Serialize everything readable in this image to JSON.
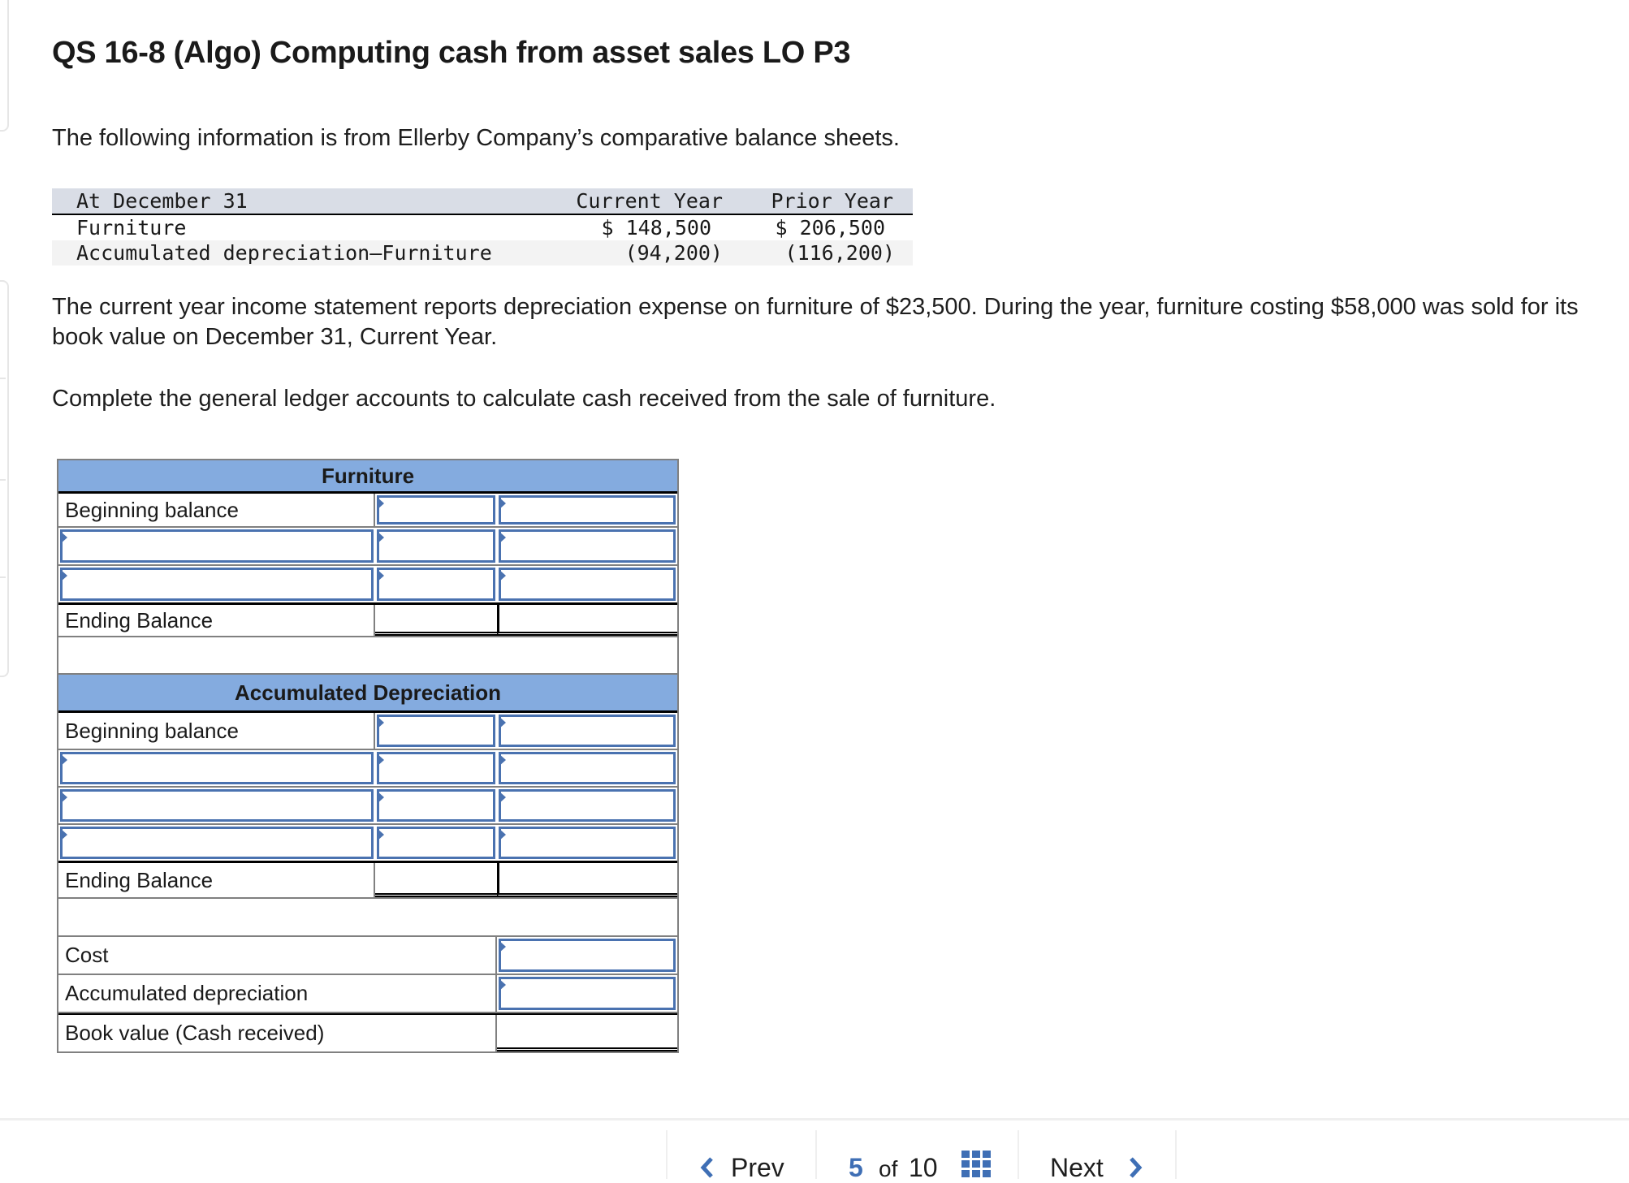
{
  "question": {
    "title": "QS 16-8 (Algo) Computing cash from asset sales LO P3",
    "intro": "The following information is from Ellerby Company’s comparative balance sheets.",
    "description": "The current year income statement reports depreciation expense on furniture of $23,500. During the year, furniture costing $58,000 was sold for its book value on December 31, Current Year.",
    "instruction": "Complete the general ledger accounts to calculate cash received from the sale of furniture."
  },
  "balance_sheet": {
    "headers": [
      "At December 31",
      "Current Year",
      "Prior Year"
    ],
    "rows": [
      {
        "label": "Furniture",
        "current": "$ 148,500",
        "prior": "$ 206,500"
      },
      {
        "label": "Accumulated depreciation—Furniture",
        "current": "(94,200)",
        "prior": "(116,200)"
      }
    ]
  },
  "ledger": {
    "furniture": {
      "title": "Furniture",
      "beginning_label": "Beginning balance",
      "ending_label": "Ending Balance"
    },
    "accumulated": {
      "title": "Accumulated Depreciation",
      "beginning_label": "Beginning balance",
      "ending_label": "Ending Balance"
    },
    "summary": {
      "cost_label": "Cost",
      "accum_label": "Accumulated depreciation",
      "book_label": "Book value (Cash received)"
    }
  },
  "nav": {
    "prev_label": "Prev",
    "next_label": "Next",
    "current_page": "5",
    "of_label": "of",
    "total_pages": "10",
    "accent_color": "#3f6fb5"
  }
}
